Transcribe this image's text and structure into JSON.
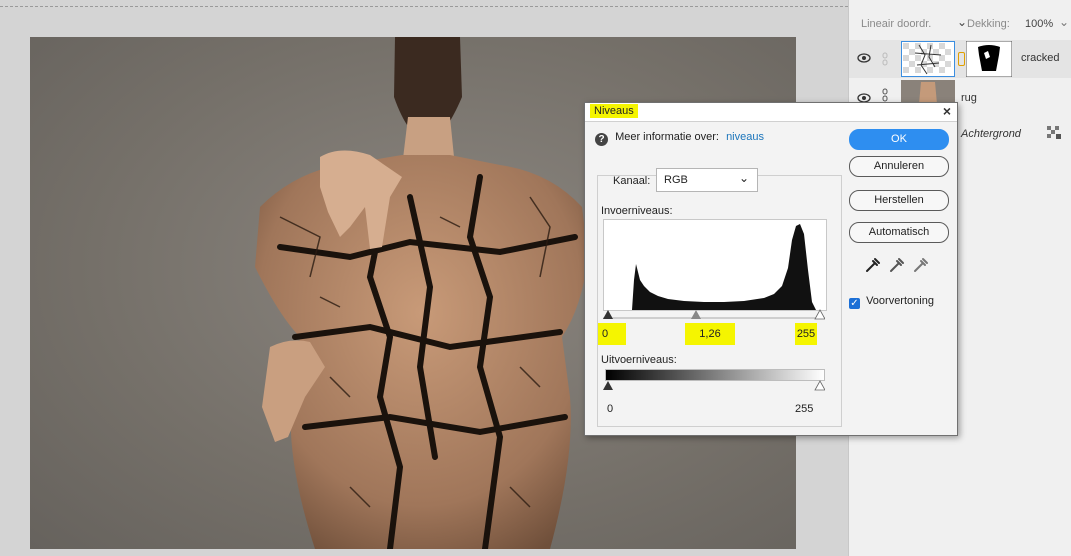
{
  "layers_panel": {
    "blend_mode": "Lineair doordr.",
    "opacity_label": "Dekking:",
    "opacity_value": "100%",
    "layers": [
      {
        "name": "cracked"
      },
      {
        "name": "rug"
      },
      {
        "name": "Achtergrond"
      }
    ]
  },
  "dialog": {
    "title": "Niveaus",
    "close": "×",
    "info_text": "Meer informatie over:",
    "info_link": "niveaus",
    "channel_label": "Kanaal:",
    "channel_value": "RGB",
    "input_label": "Invoerniveaus:",
    "input_black": "0",
    "input_gamma": "1,26",
    "input_white": "255",
    "output_label": "Uitvoerniveaus:",
    "output_black": "0",
    "output_white": "255",
    "buttons": {
      "ok": "OK",
      "cancel": "Annuleren",
      "reset": "Herstellen",
      "auto": "Automatisch"
    },
    "preview_label": "Voorvertoning",
    "preview_checked": true
  },
  "colors": {
    "highlight": "#f5f500",
    "ok_button": "#2e8ef0",
    "link": "#1b75bb"
  }
}
